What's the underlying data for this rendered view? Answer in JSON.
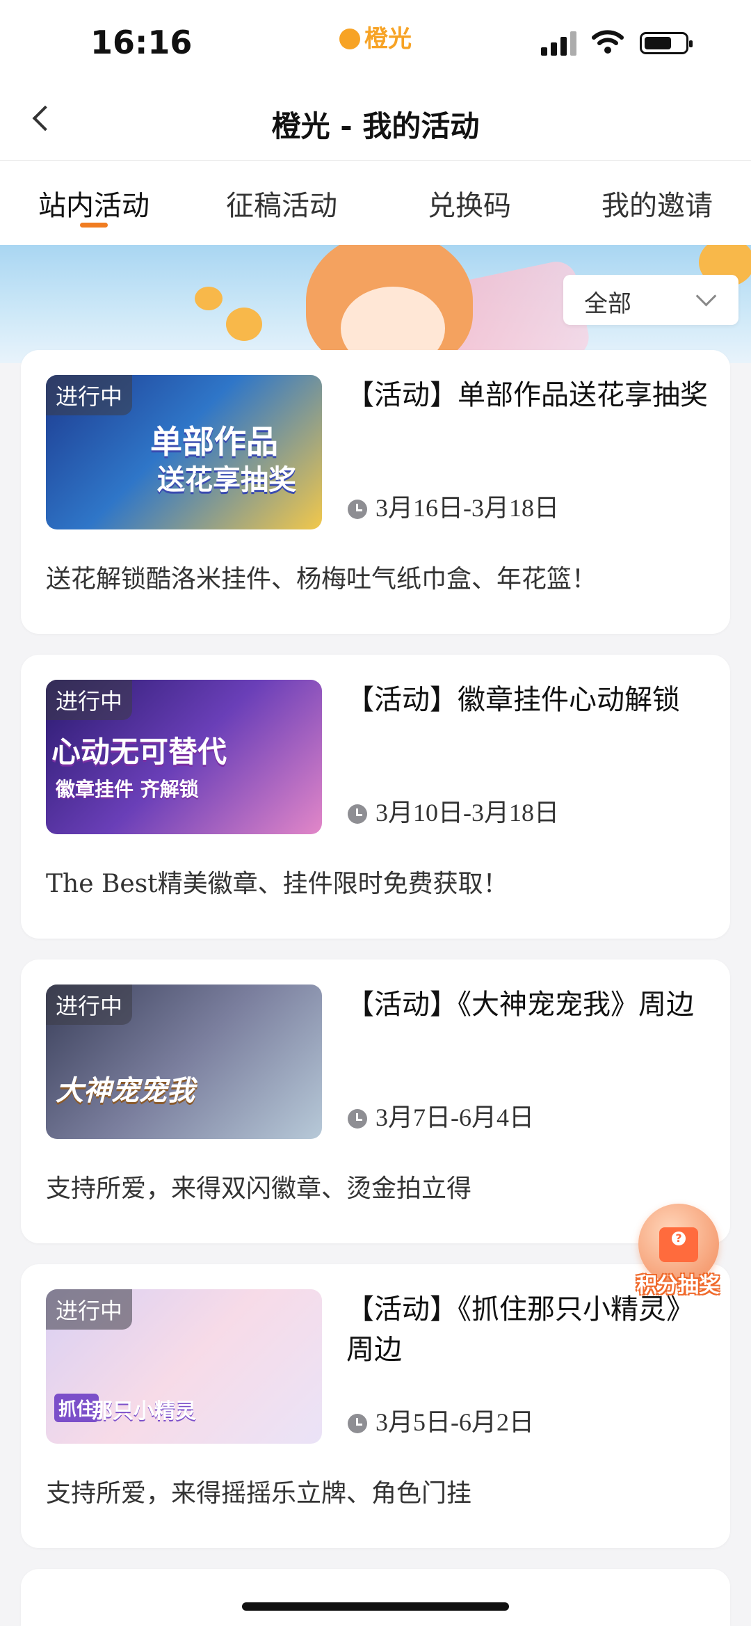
{
  "status_bar": {
    "time": "16:16",
    "brand": "橙光"
  },
  "header": {
    "title": "橙光 - 我的活动"
  },
  "tabs": [
    {
      "label": "站内活动",
      "active": true
    },
    {
      "label": "征稿活动",
      "active": false
    },
    {
      "label": "兑换码",
      "active": false
    },
    {
      "label": "我的邀请",
      "active": false
    }
  ],
  "filter": {
    "selected": "全部"
  },
  "activities": [
    {
      "status": "进行中",
      "title": "【活动】单部作品送花享抽奖",
      "date": "3月16日-3月18日",
      "description": "送花解锁酷洛米挂件、杨梅吐气纸巾盒、年花篮！",
      "thumb_text": [
        "单部作品",
        "送花享抽奖"
      ]
    },
    {
      "status": "进行中",
      "title": "【活动】徽章挂件心动解锁",
      "date": "3月10日-3月18日",
      "description": "The Best精美徽章、挂件限时免费获取！",
      "thumb_text": [
        "心动无可替代",
        "徽章挂件 齐解锁"
      ]
    },
    {
      "status": "进行中",
      "title": "【活动】《大神宠宠我》周边",
      "date": "3月7日-6月4日",
      "description": "支持所爱，来得双闪徽章、烫金拍立得",
      "thumb_text": [
        "大神宠宠我"
      ]
    },
    {
      "status": "进行中",
      "title": "【活动】《抓住那只小精灵》周边",
      "date": "3月5日-6月2日",
      "description": "支持所爱，来得摇摇乐立牌、角色门挂",
      "thumb_text": [
        "抓住",
        "那只小精灵"
      ]
    }
  ],
  "floating": {
    "lottery_label": "积分抽奖"
  }
}
